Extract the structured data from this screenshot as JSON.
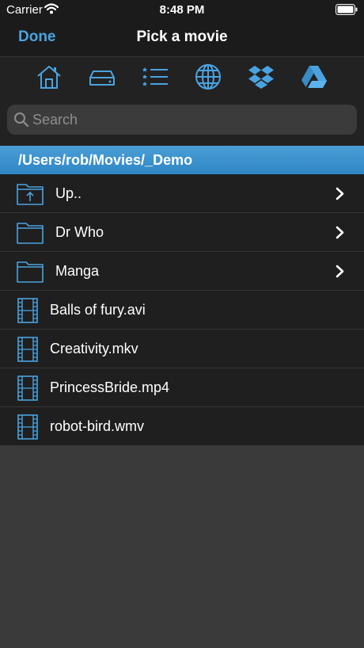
{
  "status": {
    "carrier": "Carrier",
    "time": "8:48 PM"
  },
  "nav": {
    "done_label": "Done",
    "title": "Pick a movie"
  },
  "toolbar": {
    "icons": [
      "home-icon",
      "drive-icon",
      "list-icon",
      "globe-icon",
      "dropbox-icon",
      "google-drive-icon"
    ],
    "accent": "#4aa3e0"
  },
  "search": {
    "placeholder": "Search"
  },
  "path": {
    "current": "/Users/rob/Movies/_Demo"
  },
  "list": {
    "folders": [
      {
        "label": "Up..",
        "icon": "folder-up-icon"
      },
      {
        "label": "Dr Who",
        "icon": "folder-icon"
      },
      {
        "label": "Manga",
        "icon": "folder-icon"
      }
    ],
    "files": [
      {
        "label": "Balls of fury.avi",
        "icon": "film-icon"
      },
      {
        "label": "Creativity.mkv",
        "icon": "film-icon"
      },
      {
        "label": "PrincessBride.mp4",
        "icon": "film-icon"
      },
      {
        "label": "robot-bird.wmv",
        "icon": "film-icon"
      }
    ]
  }
}
